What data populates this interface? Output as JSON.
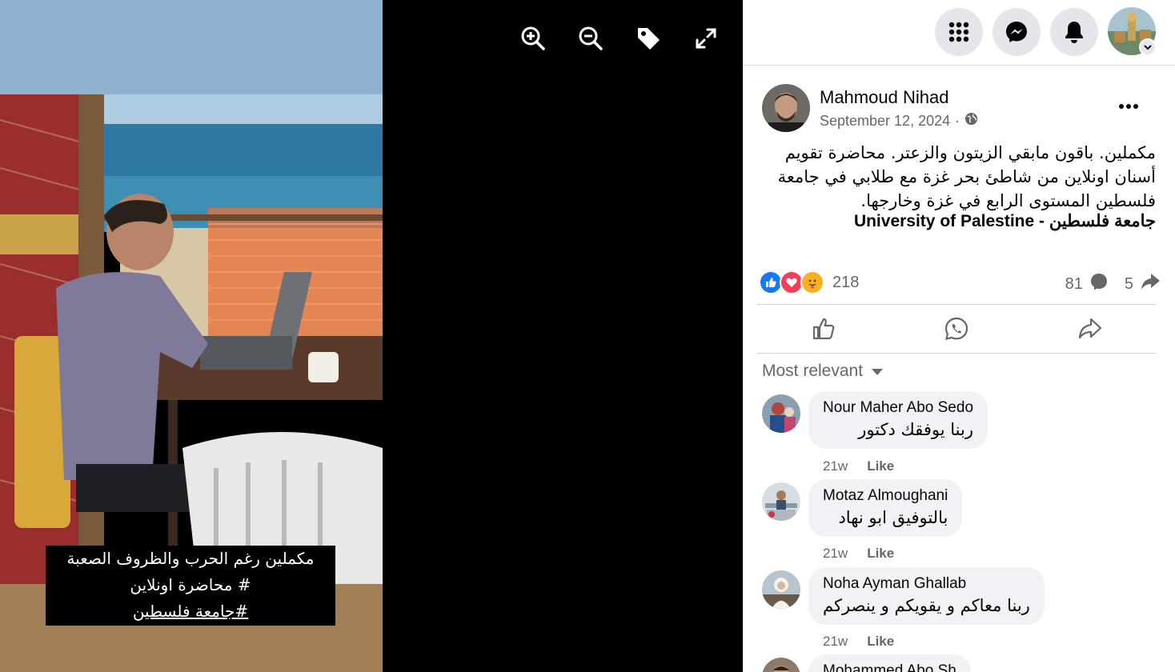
{
  "viewer": {
    "caption": {
      "line1": "مكملين رغم الحرب والظروف الصعبة",
      "line2": "# محاضرة اونلاين",
      "line3": "#جامعة فلسطين"
    },
    "tools": [
      "zoom-in-icon",
      "zoom-out-icon",
      "tag-icon",
      "fullscreen-icon"
    ]
  },
  "topbar": {
    "icons": [
      "menu-grid-icon",
      "messenger-icon",
      "bell-icon"
    ],
    "profile_badge": "chevron-down-icon"
  },
  "post": {
    "author": "Mahmoud Nihad",
    "date": "September 12, 2024",
    "date_sep": "·",
    "audience": "globe-icon",
    "text_line1": "مكملين. باقون مابقي الزيتون والزعتر. محاضرة تقويم",
    "text_line2": "أسنان اونلاين من شاطئ بحر غزة مع طلابي في جامعة",
    "text_line3": "فلسطين المستوى الرابع في غزة وخارجها.",
    "link_text": "University of Palestine - جامعة فلسطين",
    "reactions": [
      "like-icon",
      "love-icon",
      "care-icon"
    ],
    "reaction_count": "218",
    "comment_count": "81",
    "share_count": "5",
    "colors": {
      "like": "#1877f2",
      "love": "#f33e58",
      "care": "#f7b125"
    }
  },
  "actions": [
    "thumbs-up-icon",
    "whatsapp-icon",
    "share-icon"
  ],
  "sort_label": "Most relevant",
  "comments": [
    {
      "name": "Nour Maher Abo Sedo",
      "text": "ربنا يوفقك دكتور",
      "time": "21w",
      "like": "Like"
    },
    {
      "name": "Motaz Almoughani",
      "text": "بالتوفيق ابو نهاد",
      "time": "21w",
      "like": "Like"
    },
    {
      "name": "Noha Ayman Ghallab",
      "text": "ربنا معاكم و يقويكم و ينصركم",
      "time": "21w",
      "like": "Like"
    },
    {
      "name": "Mohammed Abo Sh",
      "text": "",
      "time": "",
      "like": ""
    }
  ]
}
